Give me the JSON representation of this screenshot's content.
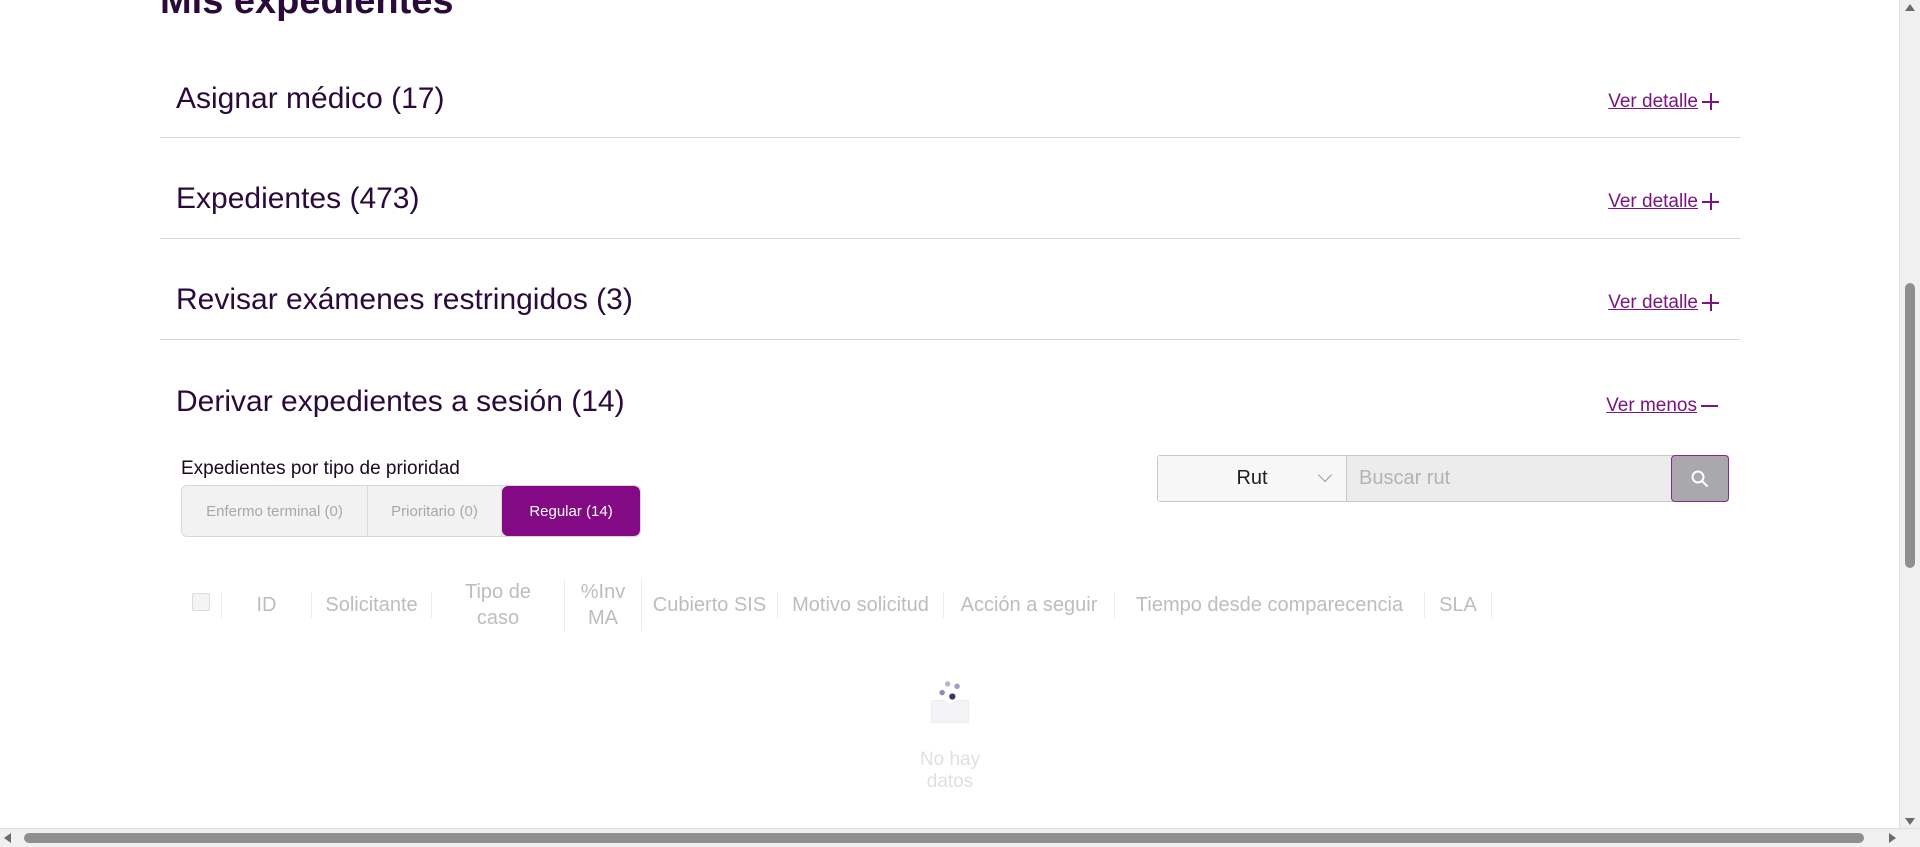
{
  "page": {
    "title": "Mis expedientes"
  },
  "sections": [
    {
      "title": "Asignar médico (17)",
      "toggle": "Ver detalle"
    },
    {
      "title": "Expedientes (473)",
      "toggle": "Ver detalle"
    },
    {
      "title": "Revisar exámenes restringidos (3)",
      "toggle": "Ver detalle"
    },
    {
      "title": "Derivar expedientes a sesión (14)",
      "toggle": "Ver menos"
    }
  ],
  "priority": {
    "label": "Expedientes por tipo de prioridad",
    "options": [
      "Enfermo terminal (0)",
      "Prioritario (0)",
      "Regular (14)"
    ],
    "selected": "Regular (14)"
  },
  "search": {
    "type_selected": "Rut",
    "placeholder": "Buscar rut"
  },
  "table": {
    "columns": [
      "ID",
      "Solicitante",
      "Tipo de caso",
      "%Inv MA",
      "Cubierto SIS",
      "Motivo solicitud",
      "Acción a seguir",
      "Tiempo desde comparecencia",
      "SLA"
    ],
    "empty_text": "No hay datos"
  },
  "colors": {
    "accent": "#840a85",
    "heading": "#2a0a3a"
  }
}
